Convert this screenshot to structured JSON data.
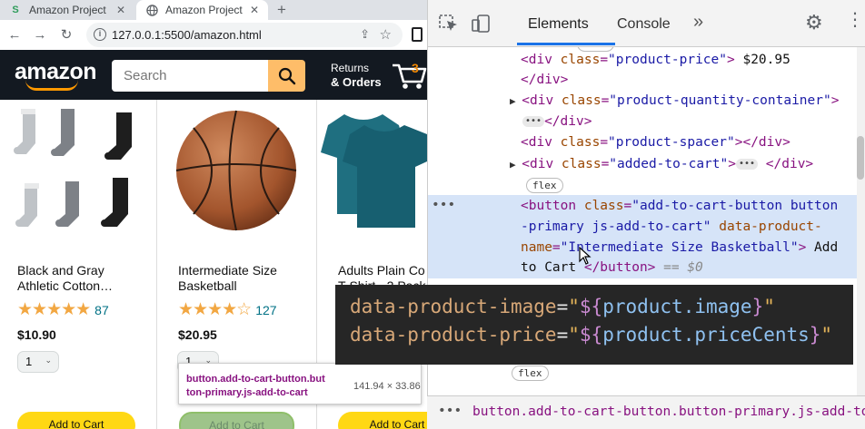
{
  "browser": {
    "tabs": [
      {
        "title": "Amazon Project",
        "active": false,
        "close": "✕"
      },
      {
        "title": "Amazon Project",
        "active": true,
        "close": "✕"
      }
    ],
    "new_tab": "+",
    "url": "127.0.0.1:5500/amazon.html",
    "colors": {
      "tabstrip": "#dee1e6",
      "omnibox": "#f1f3f4"
    }
  },
  "amazon": {
    "logo": "amazon",
    "search_placeholder": "Search",
    "returns_line1": "Returns",
    "returns_line2": "& Orders",
    "cart_count": "3",
    "colors": {
      "header": "#131921",
      "search_button": "#febd69",
      "add_to_cart": "#ffd814",
      "rating_link": "#007185"
    },
    "products": [
      {
        "name_line1": "Black and Gray",
        "name_line2": "Athletic Cotton…",
        "stars": 4.5,
        "rating_count": "87",
        "price": "$10.90",
        "quantity": "1",
        "button": "Add to Cart"
      },
      {
        "name_line1": "Intermediate Size",
        "name_line2": "Basketball",
        "stars": 4.0,
        "rating_count": "127",
        "price": "$20.95",
        "quantity": "1",
        "button": "Add to Cart"
      },
      {
        "name_line1": "Adults Plain Co",
        "name_line2": "T-Shirt - 2 Pack",
        "button": "Add to Cart"
      }
    ],
    "inspect_tooltip": {
      "selector_line1": "button.add-to-cart-button.but",
      "selector_line2": "ton-primary.js-add-to-cart",
      "dimensions": "141.94 × 33.86"
    }
  },
  "devtools": {
    "tabs": [
      "Elements",
      "Console"
    ],
    "active_tab": "Elements",
    "more": "»",
    "elements": {
      "flex_badge": "flex",
      "l1_attr": "class",
      "l1_val": "\"product-price\"",
      "l1_text": "$20.95",
      "l3_val": "\"product-quantity-container\"",
      "l5_val": "\"product-spacer\"",
      "l6_val": "\"added-to-cart\"",
      "selected_line1_val": "\"add-to-cart-button button",
      "selected_line2_val": "-primary js-add-to-cart\"",
      "selected_attr2": "data-product-",
      "selected_line3_attr": "name",
      "selected_line3_val": "\"Intermediate Size Basketball\"",
      "selected_text": "Add",
      "selected_text2": "to Cart",
      "eq_zero": "== $0"
    },
    "overlay": {
      "line1_attr": "data-product-image",
      "line1_var": "product.image",
      "line2_attr": "data-product-price",
      "line2_var": "product.priceCents"
    },
    "breadcrumb": "button.add-to-cart-button.button-primary.js-add-to-ca"
  }
}
